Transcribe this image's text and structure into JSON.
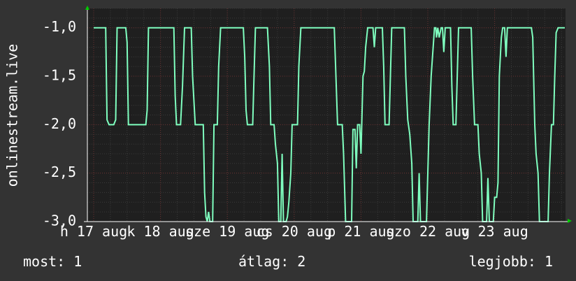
{
  "chart_data": {
    "type": "line",
    "ylabel": "onlinestream.live",
    "yticks": [
      "-1,0",
      "-1,5",
      "-2,0",
      "-2,5",
      "-3,0"
    ],
    "yvalues": [
      -1.0,
      -1.5,
      -2.0,
      -2.5,
      -3.0
    ],
    "ylim": [
      -3.0,
      -0.8
    ],
    "xlim": [
      0,
      8
    ],
    "xticks": [
      {
        "label": "h 17 aug",
        "x": 0
      },
      {
        "label": "k 18 aug",
        "x": 1
      },
      {
        "label": "sze 19 aug",
        "x": 2
      },
      {
        "label": "cs 20 aug",
        "x": 3
      },
      {
        "label": "p 21 aug",
        "x": 4
      },
      {
        "label": "szo 22 aug",
        "x": 5
      },
      {
        "label": "v 23 aug",
        "x": 6
      }
    ],
    "grid": true,
    "line_color": "#7fffbf",
    "points": [
      [
        0.0,
        -1.0
      ],
      [
        0.18,
        -1.0
      ],
      [
        0.2,
        -1.95
      ],
      [
        0.23,
        -2.0
      ],
      [
        0.3,
        -2.0
      ],
      [
        0.33,
        -1.95
      ],
      [
        0.35,
        -1.0
      ],
      [
        0.48,
        -1.0
      ],
      [
        0.5,
        -1.15
      ],
      [
        0.52,
        -2.0
      ],
      [
        0.78,
        -2.0
      ],
      [
        0.8,
        -1.85
      ],
      [
        0.82,
        -1.0
      ],
      [
        1.2,
        -1.0
      ],
      [
        1.22,
        -1.7
      ],
      [
        1.24,
        -2.0
      ],
      [
        1.3,
        -2.0
      ],
      [
        1.33,
        -1.6
      ],
      [
        1.36,
        -1.0
      ],
      [
        1.46,
        -1.0
      ],
      [
        1.48,
        -1.5
      ],
      [
        1.52,
        -2.0
      ],
      [
        1.64,
        -2.0
      ],
      [
        1.66,
        -2.7
      ],
      [
        1.68,
        -2.95
      ],
      [
        1.7,
        -3.0
      ],
      [
        1.72,
        -2.9
      ],
      [
        1.74,
        -3.0
      ],
      [
        1.78,
        -3.0
      ],
      [
        1.8,
        -2.0
      ],
      [
        1.85,
        -2.0
      ],
      [
        1.87,
        -1.4
      ],
      [
        1.9,
        -1.0
      ],
      [
        2.24,
        -1.0
      ],
      [
        2.26,
        -1.3
      ],
      [
        2.28,
        -1.85
      ],
      [
        2.3,
        -2.0
      ],
      [
        2.38,
        -2.0
      ],
      [
        2.4,
        -1.5
      ],
      [
        2.42,
        -1.0
      ],
      [
        2.6,
        -1.0
      ],
      [
        2.63,
        -1.4
      ],
      [
        2.65,
        -2.0
      ],
      [
        2.7,
        -2.0
      ],
      [
        2.72,
        -2.2
      ],
      [
        2.75,
        -2.4
      ],
      [
        2.77,
        -3.0
      ],
      [
        2.8,
        -3.0
      ],
      [
        2.82,
        -2.3
      ],
      [
        2.84,
        -3.0
      ],
      [
        2.88,
        -3.0
      ],
      [
        2.9,
        -2.95
      ],
      [
        2.92,
        -2.8
      ],
      [
        2.95,
        -2.5
      ],
      [
        2.97,
        -2.0
      ],
      [
        3.05,
        -2.0
      ],
      [
        3.07,
        -1.4
      ],
      [
        3.1,
        -1.0
      ],
      [
        3.6,
        -1.0
      ],
      [
        3.62,
        -1.4
      ],
      [
        3.65,
        -2.0
      ],
      [
        3.72,
        -2.0
      ],
      [
        3.74,
        -2.3
      ],
      [
        3.77,
        -3.0
      ],
      [
        3.86,
        -3.0
      ],
      [
        3.88,
        -2.05
      ],
      [
        3.91,
        -2.05
      ],
      [
        3.93,
        -2.45
      ],
      [
        3.95,
        -2.0
      ],
      [
        3.98,
        -2.0
      ],
      [
        4.0,
        -2.3
      ],
      [
        4.03,
        -1.5
      ],
      [
        4.05,
        -1.45
      ],
      [
        4.07,
        -1.2
      ],
      [
        4.1,
        -1.0
      ],
      [
        4.18,
        -1.0
      ],
      [
        4.2,
        -1.2
      ],
      [
        4.22,
        -1.0
      ],
      [
        4.32,
        -1.0
      ],
      [
        4.34,
        -1.4
      ],
      [
        4.36,
        -2.0
      ],
      [
        4.42,
        -2.0
      ],
      [
        4.44,
        -1.5
      ],
      [
        4.46,
        -1.0
      ],
      [
        4.65,
        -1.0
      ],
      [
        4.67,
        -1.5
      ],
      [
        4.7,
        -1.95
      ],
      [
        4.73,
        -2.1
      ],
      [
        4.76,
        -2.4
      ],
      [
        4.78,
        -3.0
      ],
      [
        4.85,
        -3.0
      ],
      [
        4.87,
        -2.5
      ],
      [
        4.89,
        -3.0
      ],
      [
        4.98,
        -3.0
      ],
      [
        5.0,
        -2.5
      ],
      [
        5.02,
        -2.0
      ],
      [
        5.05,
        -1.5
      ],
      [
        5.07,
        -1.3
      ],
      [
        5.1,
        -1.0
      ],
      [
        5.12,
        -1.0
      ],
      [
        5.13,
        -1.1
      ],
      [
        5.15,
        -1.0
      ],
      [
        5.17,
        -1.1
      ],
      [
        5.2,
        -1.0
      ],
      [
        5.22,
        -1.0
      ],
      [
        5.24,
        -1.25
      ],
      [
        5.26,
        -1.0
      ],
      [
        5.34,
        -1.0
      ],
      [
        5.36,
        -1.6
      ],
      [
        5.38,
        -2.0
      ],
      [
        5.42,
        -2.0
      ],
      [
        5.44,
        -1.5
      ],
      [
        5.46,
        -1.0
      ],
      [
        5.65,
        -1.0
      ],
      [
        5.67,
        -1.5
      ],
      [
        5.7,
        -2.0
      ],
      [
        5.75,
        -2.0
      ],
      [
        5.77,
        -2.3
      ],
      [
        5.8,
        -2.5
      ],
      [
        5.82,
        -3.0
      ],
      [
        5.88,
        -3.0
      ],
      [
        5.9,
        -2.55
      ],
      [
        5.92,
        -3.0
      ],
      [
        5.98,
        -3.0
      ],
      [
        6.0,
        -2.75
      ],
      [
        6.03,
        -2.75
      ],
      [
        6.05,
        -2.6
      ],
      [
        6.07,
        -1.5
      ],
      [
        6.1,
        -1.1
      ],
      [
        6.12,
        -1.0
      ],
      [
        6.15,
        -1.0
      ],
      [
        6.17,
        -1.3
      ],
      [
        6.19,
        -1.0
      ],
      [
        6.55,
        -1.0
      ],
      [
        6.57,
        -1.1
      ],
      [
        6.6,
        -2.0
      ],
      [
        6.62,
        -2.3
      ],
      [
        6.65,
        -2.5
      ],
      [
        6.67,
        -3.0
      ],
      [
        6.8,
        -3.0
      ],
      [
        6.82,
        -2.5
      ],
      [
        6.85,
        -2.0
      ],
      [
        6.88,
        -2.0
      ],
      [
        6.9,
        -1.5
      ],
      [
        6.92,
        -1.05
      ],
      [
        6.95,
        -1.0
      ],
      [
        7.18,
        -1.0
      ]
    ]
  },
  "stats": {
    "current": "most: 1",
    "average": "átlag: 2",
    "best": "legjobb: 1"
  }
}
